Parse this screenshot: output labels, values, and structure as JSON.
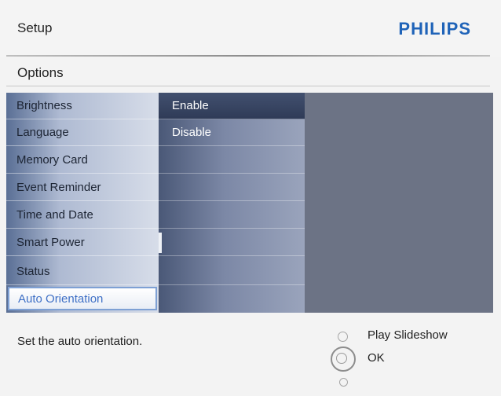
{
  "header": {
    "title": "Setup",
    "brand": "PHILIPS"
  },
  "section": {
    "title": "Options"
  },
  "menu": {
    "items": [
      {
        "label": "Brightness"
      },
      {
        "label": "Language"
      },
      {
        "label": "Memory Card"
      },
      {
        "label": "Event Reminder"
      },
      {
        "label": "Time and Date"
      },
      {
        "label": "Smart Power"
      },
      {
        "label": "Status"
      },
      {
        "label": "Auto Orientation"
      }
    ],
    "selected": "Auto Orientation"
  },
  "submenu": {
    "items": [
      {
        "label": "Enable"
      },
      {
        "label": "Disable"
      }
    ],
    "selected": "Enable"
  },
  "footer": {
    "description": "Set the auto orientation.",
    "nav": {
      "up_label": "Play Slideshow",
      "ok_label": "OK"
    }
  },
  "colors": {
    "brand": "#1f63b8",
    "selected_text": "#3f70c6",
    "panel": "#6c7385"
  }
}
